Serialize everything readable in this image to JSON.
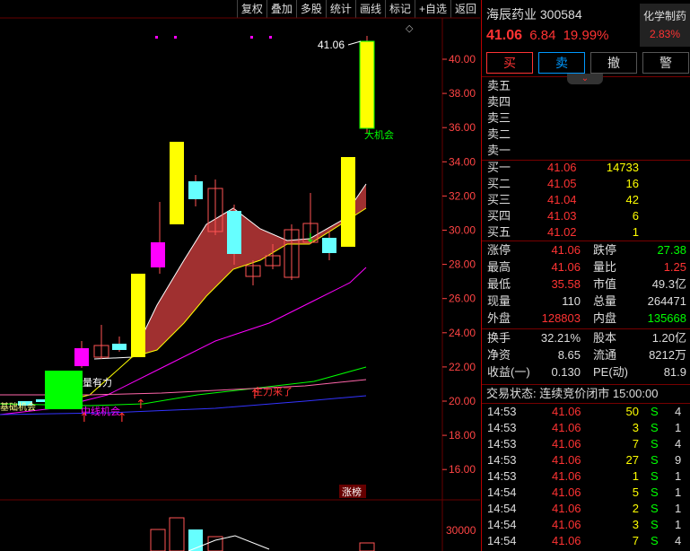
{
  "toolbar": [
    "复权",
    "叠加",
    "多股",
    "统计",
    "画线",
    "标记",
    "+自选",
    "返回"
  ],
  "stock": {
    "name": "海辰药业",
    "code": "300584",
    "price": "41.06",
    "change": "6.84",
    "pct": "19.99%",
    "sector": "化学制药",
    "sector_pct": "2.83%"
  },
  "actions": {
    "buy": "买",
    "sell": "卖",
    "cancel": "撤",
    "alert": "警"
  },
  "asks": [
    {
      "label": "卖五"
    },
    {
      "label": "卖四"
    },
    {
      "label": "卖三"
    },
    {
      "label": "卖二"
    },
    {
      "label": "卖一"
    }
  ],
  "bids": [
    {
      "label": "买一",
      "price": "41.06",
      "vol": "14733"
    },
    {
      "label": "买二",
      "price": "41.05",
      "vol": "16"
    },
    {
      "label": "买三",
      "price": "41.04",
      "vol": "42"
    },
    {
      "label": "买四",
      "price": "41.03",
      "vol": "6"
    },
    {
      "label": "买五",
      "price": "41.02",
      "vol": "1"
    }
  ],
  "stats": [
    [
      {
        "l": "涨停",
        "v": "41.06",
        "c": "red"
      },
      {
        "l": "跌停",
        "v": "27.38",
        "c": "green"
      }
    ],
    [
      {
        "l": "最高",
        "v": "41.06",
        "c": "red"
      },
      {
        "l": "量比",
        "v": "1.25",
        "c": "red"
      }
    ],
    [
      {
        "l": "最低",
        "v": "35.58",
        "c": "red"
      },
      {
        "l": "市值",
        "v": "49.3亿",
        "c": "white"
      }
    ],
    [
      {
        "l": "现量",
        "v": "110",
        "c": "white"
      },
      {
        "l": "总量",
        "v": "264471",
        "c": "white"
      }
    ],
    [
      {
        "l": "外盘",
        "v": "128803",
        "c": "red"
      },
      {
        "l": "内盘",
        "v": "135668",
        "c": "green"
      }
    ]
  ],
  "stats2": [
    [
      {
        "l": "换手",
        "v": "32.21%",
        "c": "white"
      },
      {
        "l": "股本",
        "v": "1.20亿",
        "c": "white"
      }
    ],
    [
      {
        "l": "净资",
        "v": "8.65",
        "c": "white"
      },
      {
        "l": "流通",
        "v": "8212万",
        "c": "white"
      }
    ],
    [
      {
        "l": "收益(一)",
        "v": "0.130",
        "c": "white"
      },
      {
        "l": "PE(动)",
        "v": "81.9",
        "c": "white"
      }
    ]
  ],
  "trade_status": "交易状态: 连续竞价闭市 15:00:00",
  "ticks": [
    {
      "t": "14:53",
      "p": "41.06",
      "v": "50",
      "s": "S",
      "n": "4"
    },
    {
      "t": "14:53",
      "p": "41.06",
      "v": "3",
      "s": "S",
      "n": "1"
    },
    {
      "t": "14:53",
      "p": "41.06",
      "v": "7",
      "s": "S",
      "n": "4"
    },
    {
      "t": "14:53",
      "p": "41.06",
      "v": "27",
      "s": "S",
      "n": "9"
    },
    {
      "t": "14:53",
      "p": "41.06",
      "v": "1",
      "s": "S",
      "n": "1"
    },
    {
      "t": "14:54",
      "p": "41.06",
      "v": "5",
      "s": "S",
      "n": "1"
    },
    {
      "t": "14:54",
      "p": "41.06",
      "v": "2",
      "s": "S",
      "n": "1"
    },
    {
      "t": "14:54",
      "p": "41.06",
      "v": "3",
      "s": "S",
      "n": "1"
    },
    {
      "t": "14:54",
      "p": "41.06",
      "v": "7",
      "s": "S",
      "n": "4"
    }
  ],
  "chart": {
    "y_ticks": [
      "40.00",
      "38.00",
      "36.00",
      "34.00",
      "32.00",
      "30.00",
      "28.00",
      "26.00",
      "24.00",
      "22.00",
      "20.00",
      "18.00",
      "16.00"
    ],
    "vol_tick": "30000",
    "last_label": "41.06",
    "annotations": [
      "大机会",
      "量有力",
      "中线机会",
      "主力来了",
      "基础机会"
    ],
    "badge": "涨榜",
    "colors": {
      "up": "#ffff00",
      "down": "#66ffff",
      "limit": "#00ff00",
      "magenta": "#ff00ff",
      "band": "#a03030"
    }
  }
}
